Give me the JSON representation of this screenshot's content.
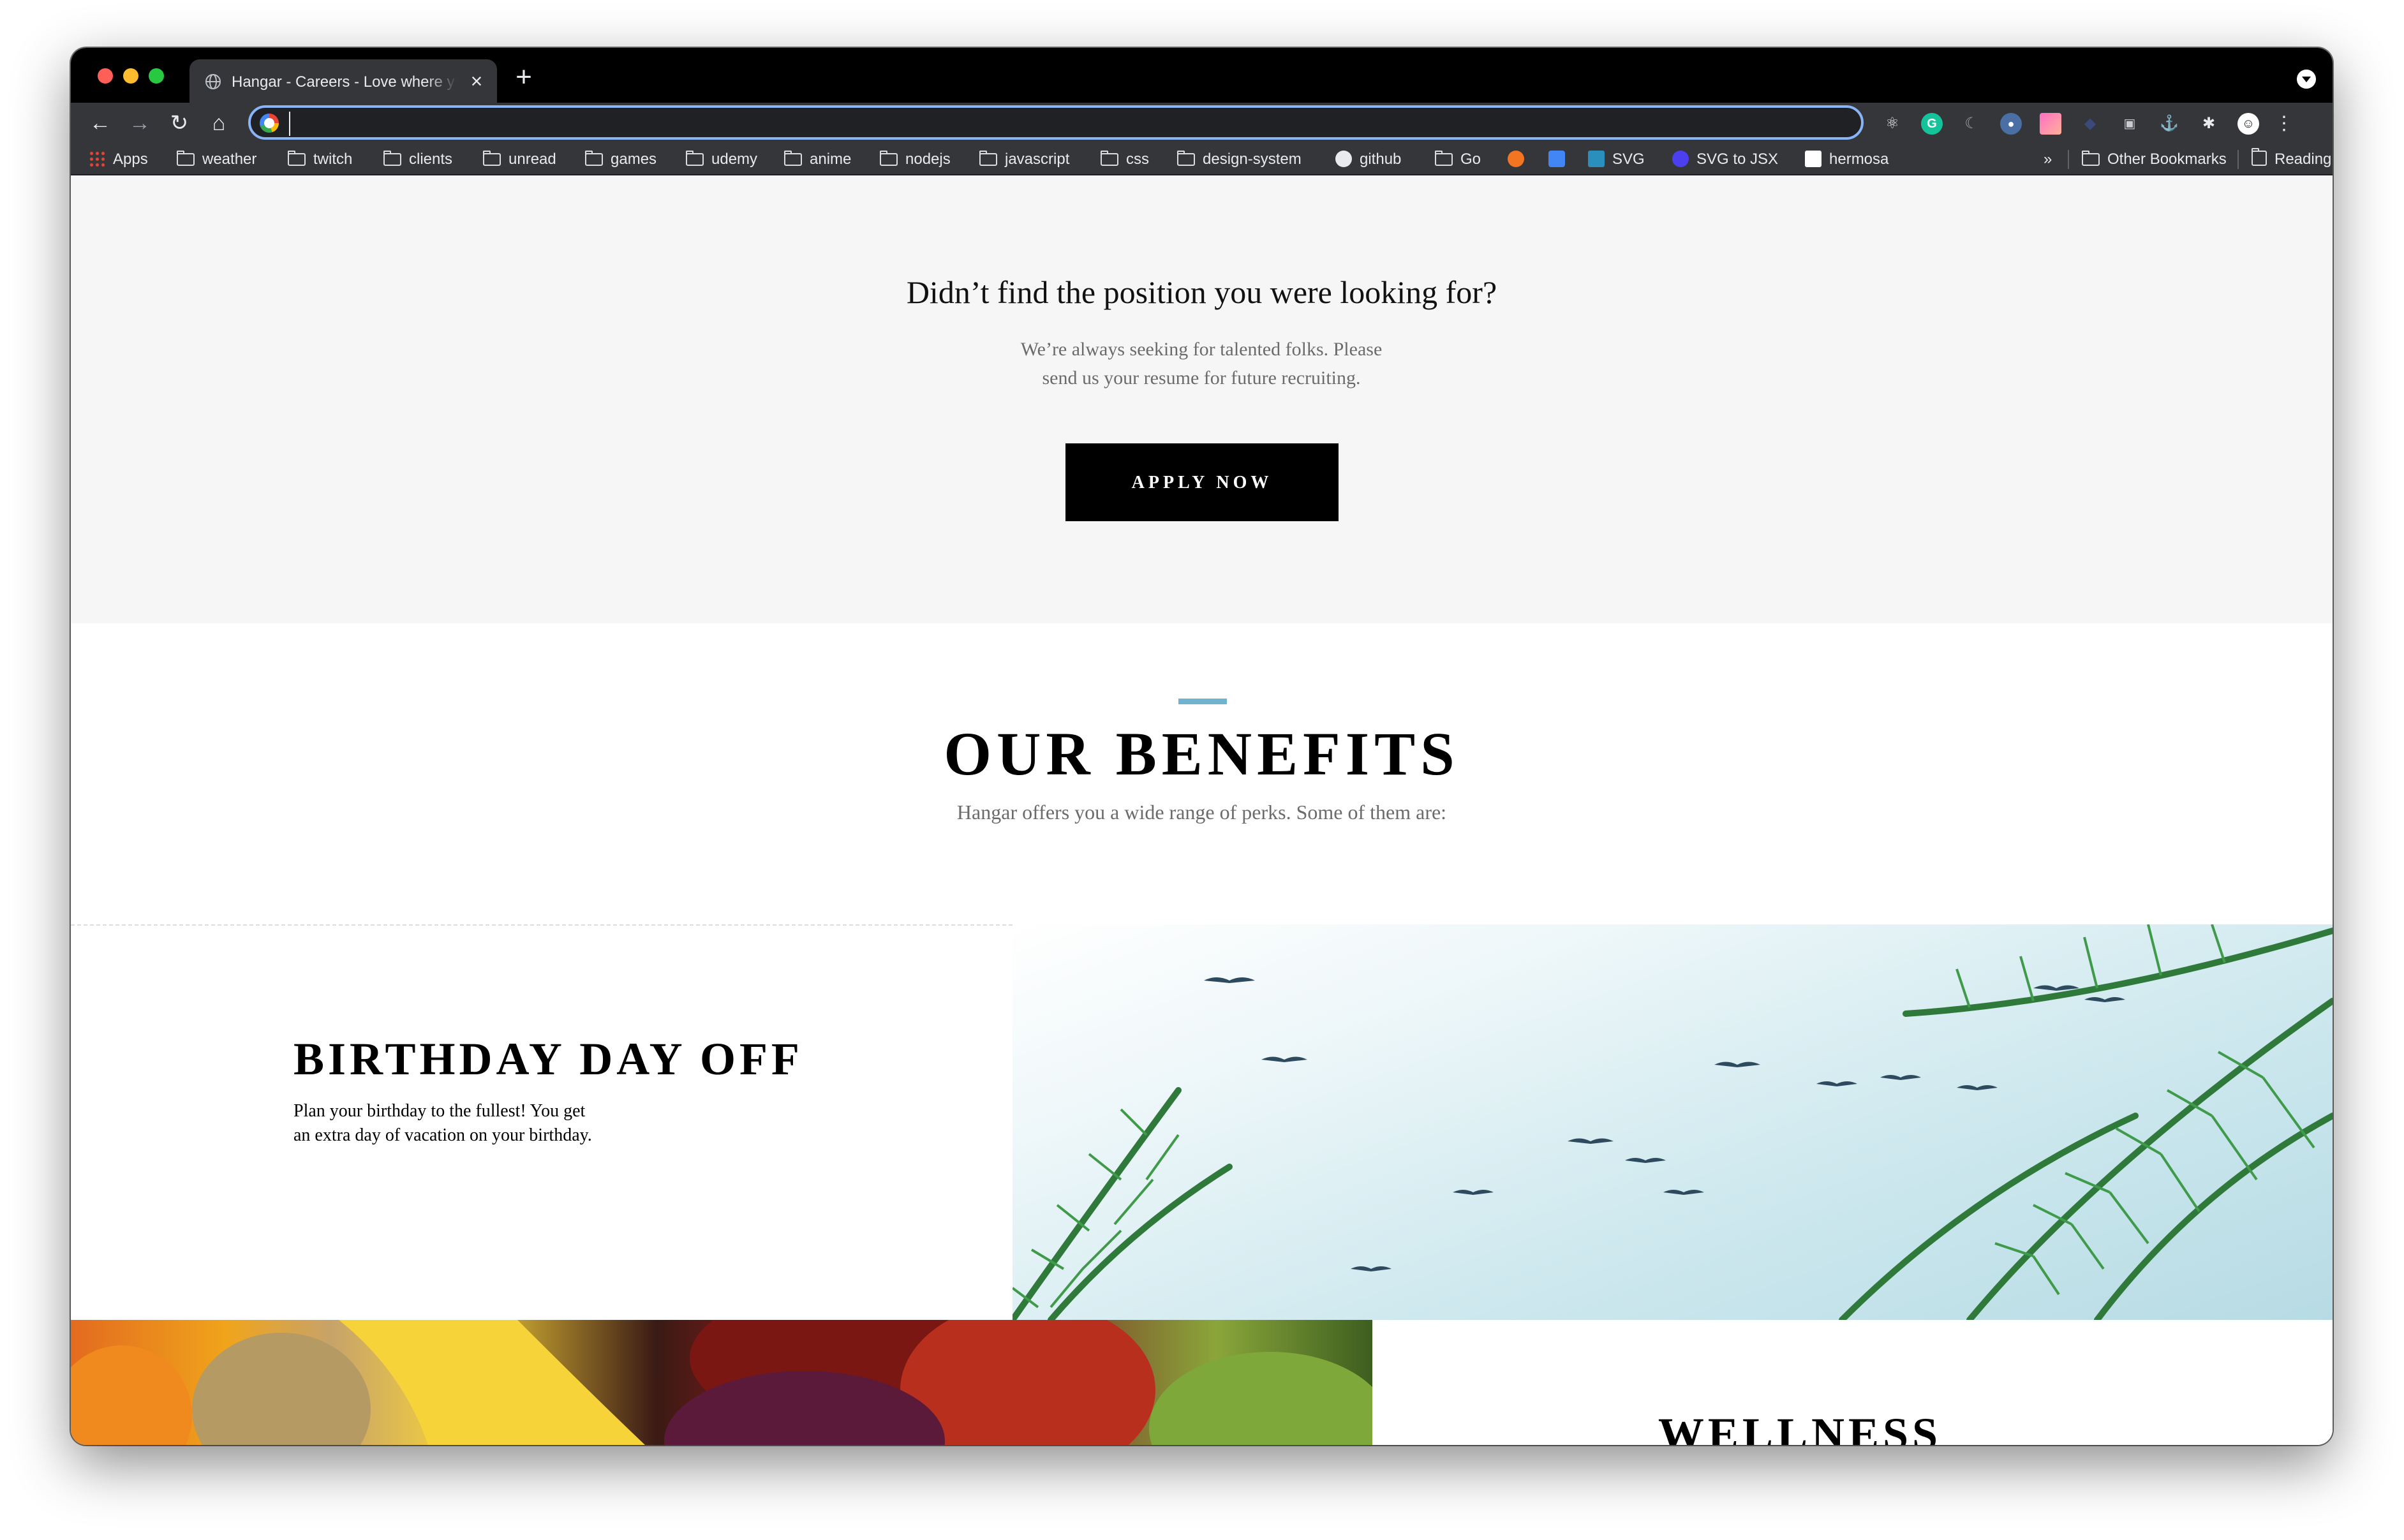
{
  "browser": {
    "tab": {
      "title": "Hangar - Careers - Love where you work",
      "close_icon": "close-icon",
      "favicon": "globe-icon"
    },
    "new_tab_label": "+",
    "omnibox": {
      "value": "",
      "placeholder": ""
    },
    "nav": {
      "back_icon": "arrow-left-icon",
      "forward_icon": "arrow-right-icon",
      "reload_icon": "reload-icon",
      "home_icon": "home-icon"
    },
    "bookmarks": [
      {
        "label": "Apps",
        "icon": "apps-grid-icon"
      },
      {
        "label": "weather",
        "icon": "folder-icon"
      },
      {
        "label": "twitch",
        "icon": "folder-icon"
      },
      {
        "label": "clients",
        "icon": "folder-icon"
      },
      {
        "label": "unread",
        "icon": "folder-icon"
      },
      {
        "label": "games",
        "icon": "folder-icon"
      },
      {
        "label": "udemy",
        "icon": "folder-icon"
      },
      {
        "label": "anime",
        "icon": "folder-icon"
      },
      {
        "label": "nodejs",
        "icon": "folder-icon"
      },
      {
        "label": "javascript",
        "icon": "folder-icon"
      },
      {
        "label": "css",
        "icon": "folder-icon"
      },
      {
        "label": "design-system",
        "icon": "folder-icon"
      },
      {
        "label": "github",
        "icon": "github-icon"
      },
      {
        "label": "Go",
        "icon": "folder-icon"
      },
      {
        "label": "",
        "icon": "crunchyroll-icon"
      },
      {
        "label": "",
        "icon": "translate-icon"
      },
      {
        "label": "SVG",
        "icon": "svg-icon"
      },
      {
        "label": "SVG to JSX",
        "icon": "svg-to-jsx-icon"
      },
      {
        "label": "hermosa",
        "icon": "hermosa-icon"
      }
    ],
    "bookmarks_overflow": "»",
    "other_bookmarks": "Other Bookmarks",
    "reading_list": "Reading List"
  },
  "page": {
    "cta": {
      "heading": "Didn’t find the position you were looking for?",
      "sub_line1": "We’re always seeking for talented folks. Please",
      "sub_line2": "send us your resume for future recruiting.",
      "button": "APPLY NOW"
    },
    "benefits": {
      "title": "OUR BENEFITS",
      "subtitle": "Hangar offers you a wide range of perks. Some of them are:",
      "items": [
        {
          "title": "BIRTHDAY DAY OFF",
          "text": "Plan your birthday to the fullest! You get an extra day of vacation on your birthday."
        },
        {
          "title": "WELLNESS",
          "text": ""
        }
      ]
    }
  },
  "colors": {
    "accent_rule": "#6fb3cf",
    "cta_background": "#f6f6f6",
    "button_background": "#000000"
  }
}
